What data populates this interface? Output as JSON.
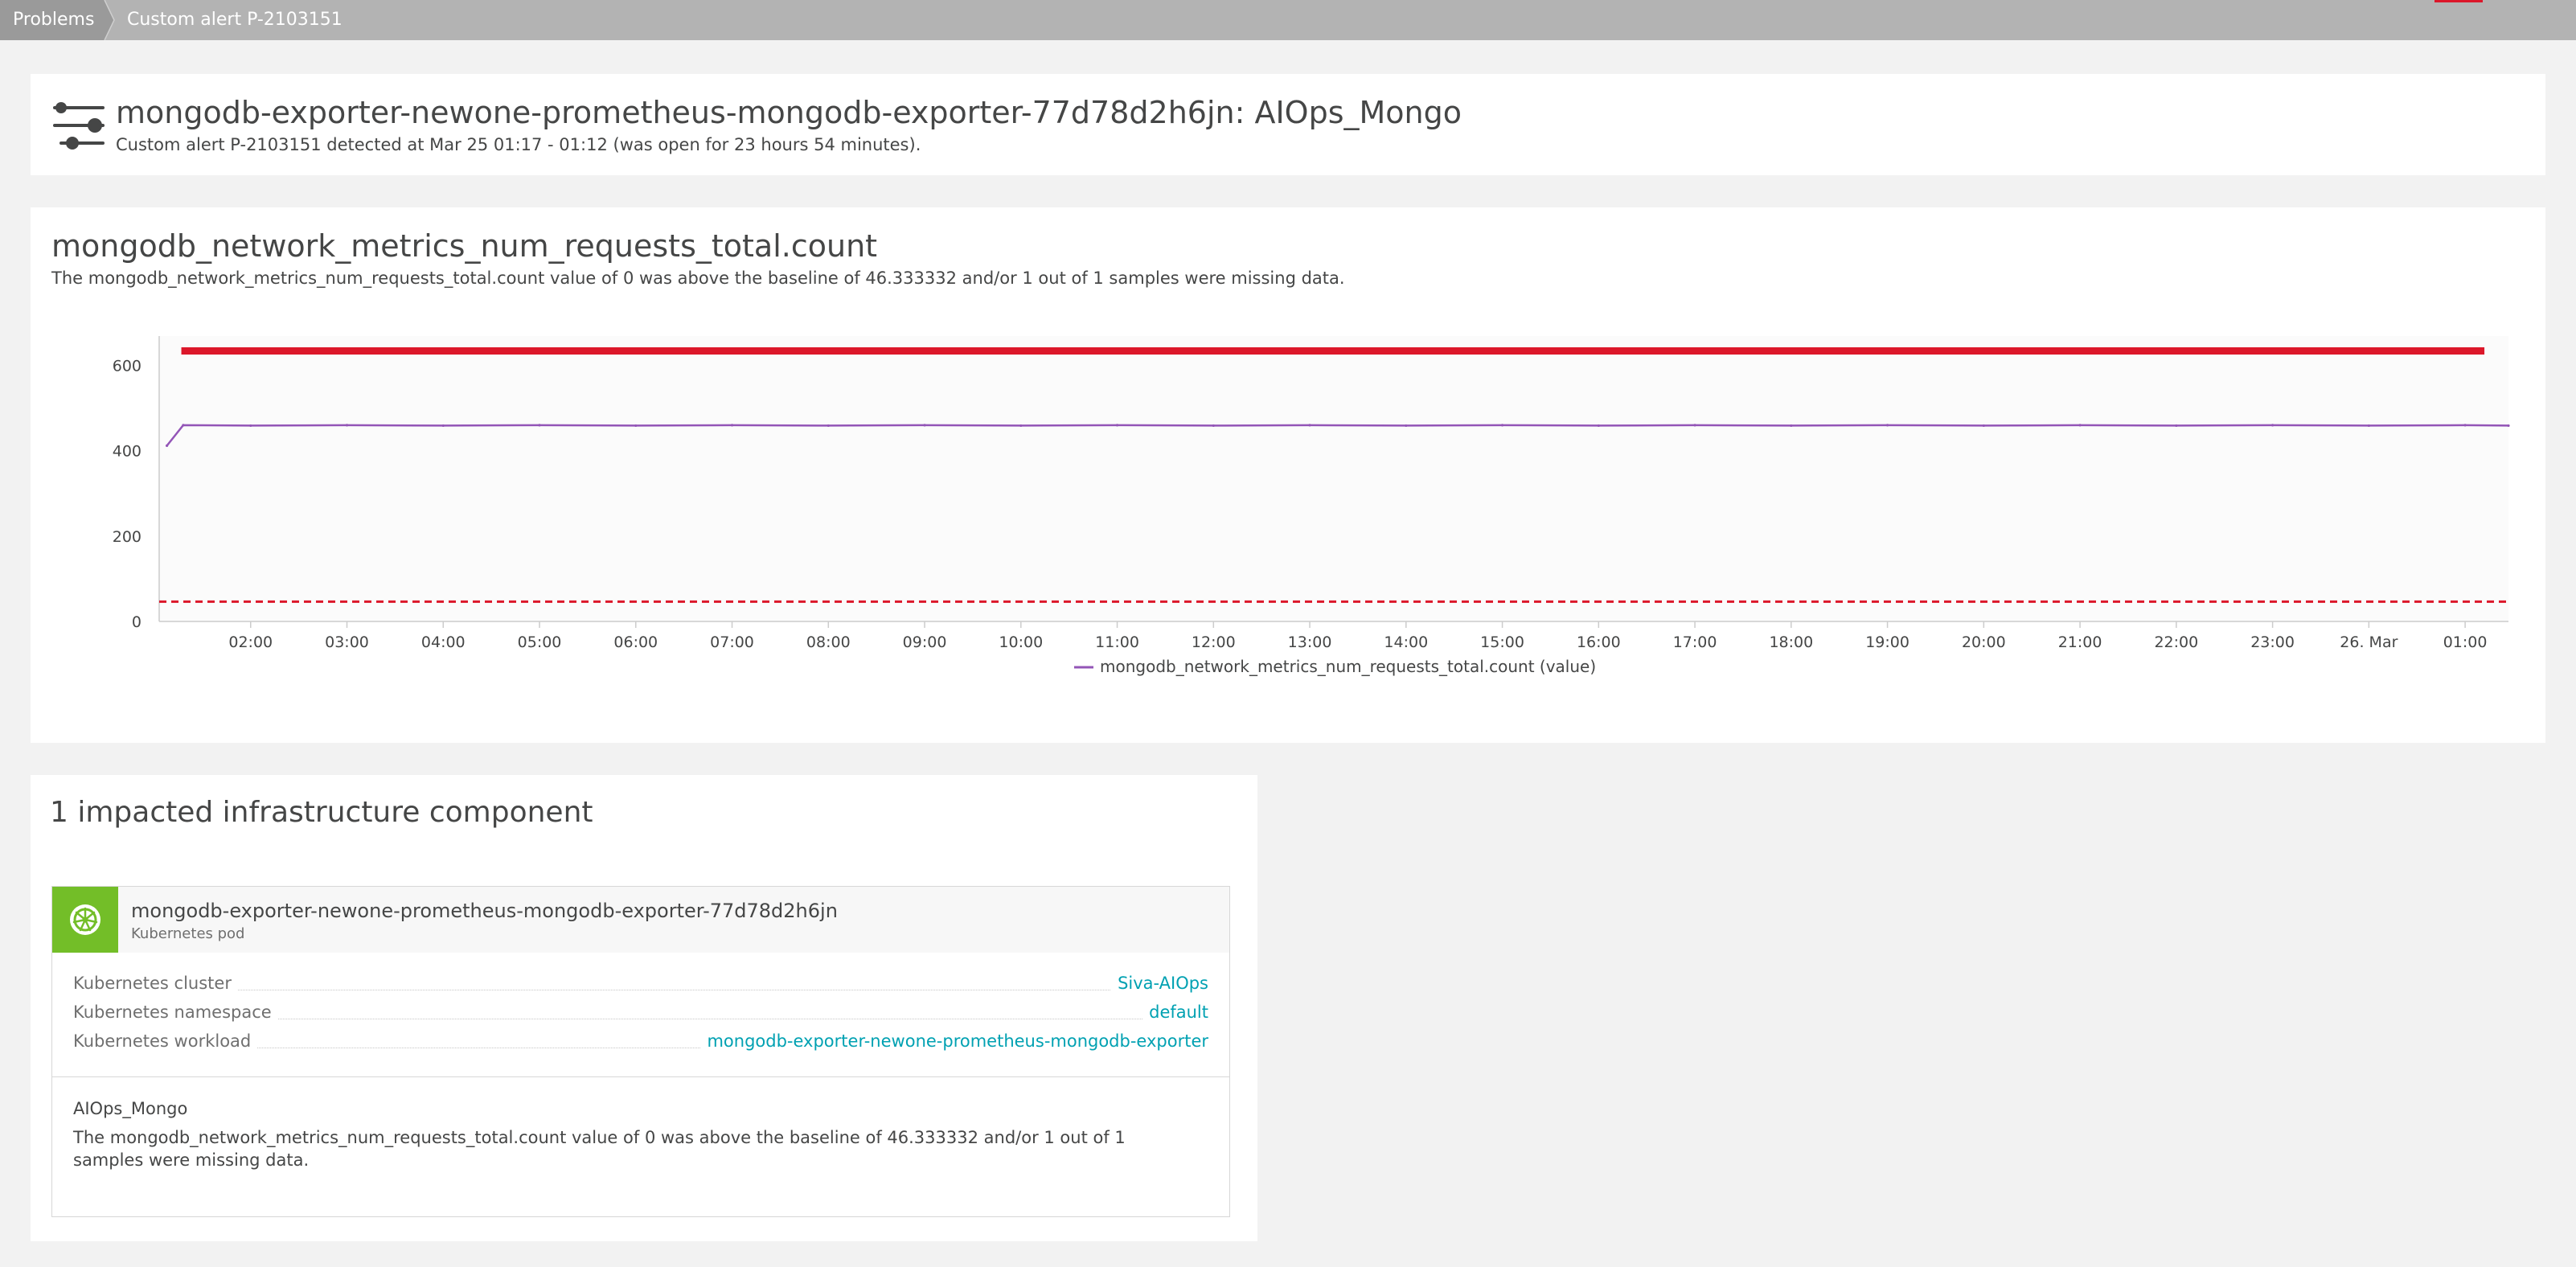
{
  "breadcrumb": {
    "items": [
      "Problems",
      "Custom alert P-2103151"
    ]
  },
  "alert": {
    "title": "mongodb-exporter-newone-prometheus-mongodb-exporter-77d78d2h6jn: AIOps_Mongo",
    "subtitle": "Custom alert P-2103151 detected at Mar 25 01:17 - 01:12 (was open for 23 hours 54 minutes).",
    "icon": "sliders-icon"
  },
  "metric": {
    "title": "mongodb_network_metrics_num_requests_total.count",
    "description": "The mongodb_network_metrics_num_requests_total.count value of 0 was above the baseline of 46.333332 and/or 1 out of 1 samples were missing data."
  },
  "chart_data": {
    "type": "line",
    "x_ticks": [
      "02:00",
      "03:00",
      "04:00",
      "05:00",
      "06:00",
      "07:00",
      "08:00",
      "09:00",
      "10:00",
      "11:00",
      "12:00",
      "13:00",
      "14:00",
      "15:00",
      "16:00",
      "17:00",
      "18:00",
      "19:00",
      "20:00",
      "21:00",
      "22:00",
      "23:00",
      "26. Mar",
      "01:00"
    ],
    "y_ticks": [
      0,
      200,
      400,
      600
    ],
    "ylim": [
      0,
      620
    ],
    "x_range_hours": [
      1.05,
      25.45
    ],
    "series": [
      {
        "name": "mongodb_network_metrics_num_requests_total.count (value)",
        "color": "#9355b7",
        "points": [
          [
            1.13,
            412
          ],
          [
            1.3,
            460
          ],
          [
            2,
            459
          ],
          [
            3,
            460
          ],
          [
            4,
            459
          ],
          [
            5,
            460
          ],
          [
            6,
            459
          ],
          [
            7,
            460
          ],
          [
            8,
            459
          ],
          [
            9,
            460
          ],
          [
            10,
            459
          ],
          [
            11,
            460
          ],
          [
            12,
            459
          ],
          [
            13,
            460
          ],
          [
            14,
            459
          ],
          [
            15,
            460
          ],
          [
            16,
            459
          ],
          [
            17,
            460
          ],
          [
            18,
            459
          ],
          [
            19,
            460
          ],
          [
            20,
            459
          ],
          [
            21,
            460
          ],
          [
            22,
            459
          ],
          [
            23,
            460
          ],
          [
            24,
            459
          ],
          [
            25,
            460
          ],
          [
            25.45,
            459
          ]
        ]
      }
    ],
    "baseline": {
      "value": 46.333332,
      "color": "#dc172a",
      "style": "dashed"
    },
    "problem_period": {
      "from_hours": 1.28,
      "to_hours": 25.2,
      "color": "#dc172a"
    },
    "legend_position": "bottom-center",
    "grid": false
  },
  "impact": {
    "title": "1 impacted infrastructure component",
    "entity": {
      "name": "mongodb-exporter-newone-prometheus-mongodb-exporter-77d78d2h6jn",
      "type": "Kubernetes pod",
      "icon": "kubernetes-icon",
      "properties": [
        {
          "key": "Kubernetes cluster",
          "value": "Siva-AIOps"
        },
        {
          "key": "Kubernetes namespace",
          "value": "default"
        },
        {
          "key": "Kubernetes workload",
          "value": "mongodb-exporter-newone-prometheus-mongodb-exporter"
        }
      ],
      "event_title": "AIOps_Mongo",
      "event_description": "The mongodb_network_metrics_num_requests_total.count value of 0 was above the baseline of 46.333332 and/or 1 out of 1 samples were missing data."
    }
  },
  "colors": {
    "accent": "#00a1b2",
    "problem_red": "#dc172a",
    "series_purple": "#9355b7",
    "kubernetes_green": "#73be28"
  }
}
